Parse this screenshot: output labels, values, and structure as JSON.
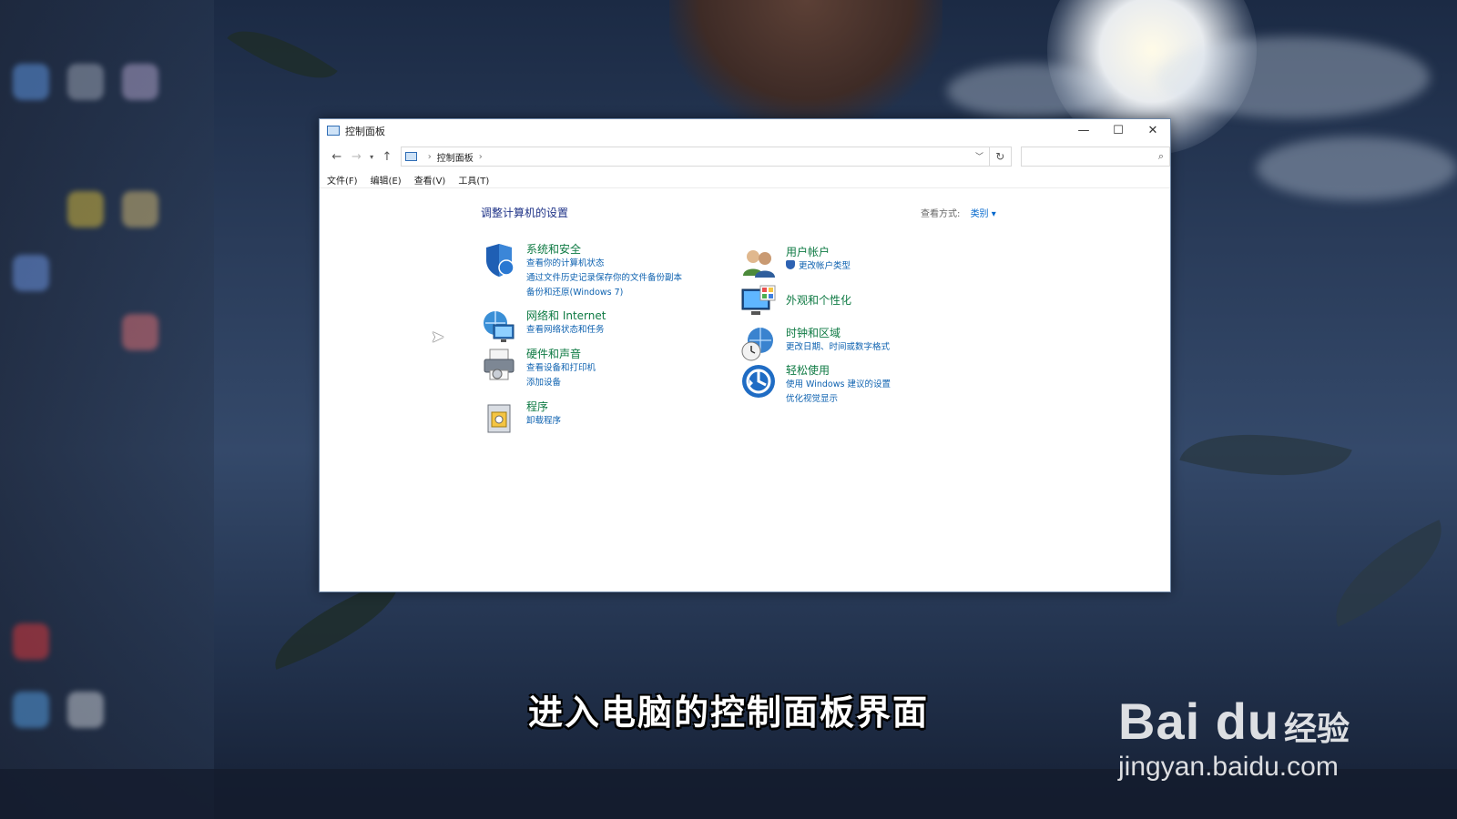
{
  "window": {
    "title": "控制面板",
    "controls": {
      "minimize": "—",
      "maximize": "☐",
      "close": "✕"
    }
  },
  "address": {
    "breadcrumb": "控制面板",
    "separator": "›",
    "search_placeholder": ""
  },
  "menu": [
    "文件(F)",
    "编辑(E)",
    "查看(V)",
    "工具(T)"
  ],
  "page": {
    "title": "调整计算机的设置",
    "view_by_label": "查看方式:",
    "view_by_value": "类别 ▾"
  },
  "categories_left": [
    {
      "title": "系统和安全",
      "links": [
        "查看你的计算机状态",
        "通过文件历史记录保存你的文件备份副本",
        "备份和还原(Windows 7)"
      ],
      "icon": "shield-icon"
    },
    {
      "title": "网络和 Internet",
      "links": [
        "查看网络状态和任务"
      ],
      "icon": "network-icon"
    },
    {
      "title": "硬件和声音",
      "links": [
        "查看设备和打印机",
        "添加设备"
      ],
      "icon": "printer-icon"
    },
    {
      "title": "程序",
      "links": [
        "卸载程序"
      ],
      "icon": "programs-icon"
    }
  ],
  "categories_right": [
    {
      "title": "用户帐户",
      "links": [
        "更改帐户类型"
      ],
      "icon": "users-icon"
    },
    {
      "title": "外观和个性化",
      "links": [],
      "icon": "display-icon"
    },
    {
      "title": "时钟和区域",
      "links": [
        "更改日期、时间或数字格式"
      ],
      "icon": "clock-icon"
    },
    {
      "title": "轻松使用",
      "links": [
        "使用 Windows 建议的设置",
        "优化视觉显示"
      ],
      "icon": "accessibility-icon"
    }
  ],
  "overlay": {
    "subtitle": "进入电脑的控制面板界面",
    "watermark_brand": "Bai du",
    "watermark_jingyan": "经验",
    "watermark_url": "jingyan.baidu.com"
  },
  "colors": {
    "category_title": "#0e7a43",
    "link": "#0e62b0",
    "page_title": "#1e3287"
  }
}
